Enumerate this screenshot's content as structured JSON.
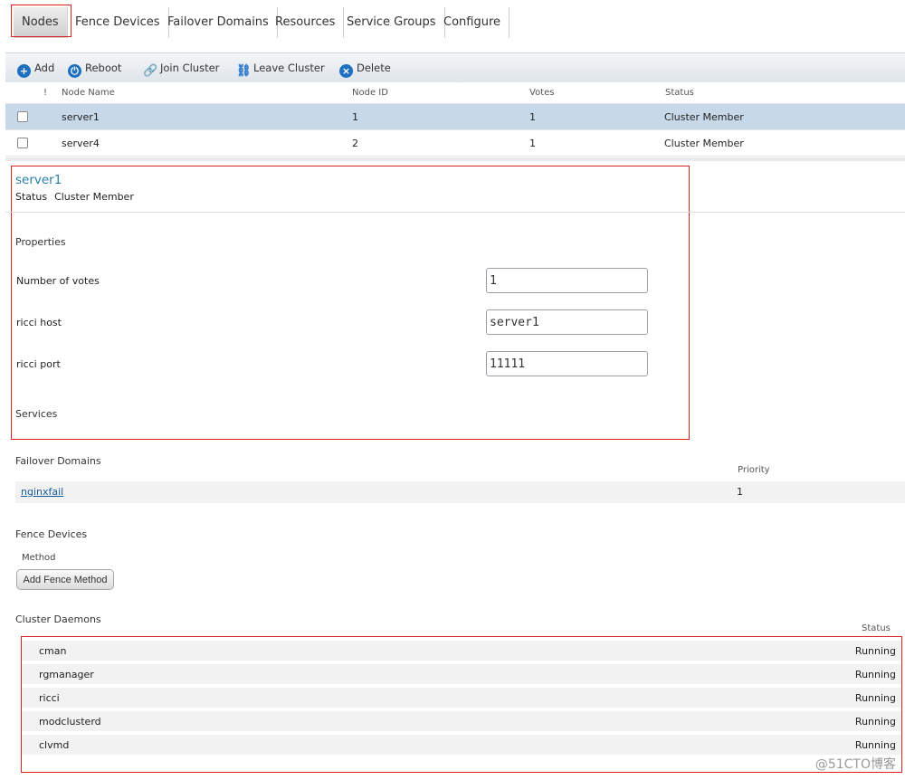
{
  "tabs": [
    {
      "label": "Nodes",
      "active": true
    },
    {
      "label": "Fence Devices",
      "active": false
    },
    {
      "label": "Failover Domains",
      "active": false
    },
    {
      "label": "Resources",
      "active": false
    },
    {
      "label": "Service Groups",
      "active": false
    },
    {
      "label": "Configure",
      "active": false
    }
  ],
  "toolbar": {
    "add": "Add",
    "reboot": "Reboot",
    "join": "Join Cluster",
    "leave": "Leave Cluster",
    "delete": "Delete"
  },
  "node_table": {
    "columns": {
      "flag": "!",
      "name": "Node Name",
      "id": "Node ID",
      "votes": "Votes",
      "status": "Status"
    },
    "rows": [
      {
        "name": "server1",
        "id": "1",
        "votes": "1",
        "status": "Cluster Member",
        "selected": true
      },
      {
        "name": "server4",
        "id": "2",
        "votes": "1",
        "status": "Cluster Member",
        "selected": false
      }
    ]
  },
  "detail": {
    "title": "server1",
    "status_label": "Status",
    "status_value": "Cluster Member",
    "properties_heading": "Properties",
    "votes_label": "Number of votes",
    "votes_value": "1",
    "ricci_host_label": "ricci host",
    "ricci_host_value": "server1",
    "ricci_port_label": "ricci port",
    "ricci_port_value": "11111",
    "services_heading": "Services"
  },
  "failover": {
    "heading": "Failover Domains",
    "priority_header": "Priority",
    "domain": "nginxfail",
    "priority": "1"
  },
  "fence": {
    "heading": "Fence Devices",
    "method_label": "Method",
    "add_button": "Add Fence Method"
  },
  "daemons": {
    "heading": "Cluster Daemons",
    "status_header": "Status",
    "rows": [
      {
        "name": "cman",
        "status": "Running"
      },
      {
        "name": "rgmanager",
        "status": "Running"
      },
      {
        "name": "ricci",
        "status": "Running"
      },
      {
        "name": "modclusterd",
        "status": "Running"
      },
      {
        "name": "clvmd",
        "status": "Running"
      }
    ]
  },
  "watermark": "@51CTO博客"
}
